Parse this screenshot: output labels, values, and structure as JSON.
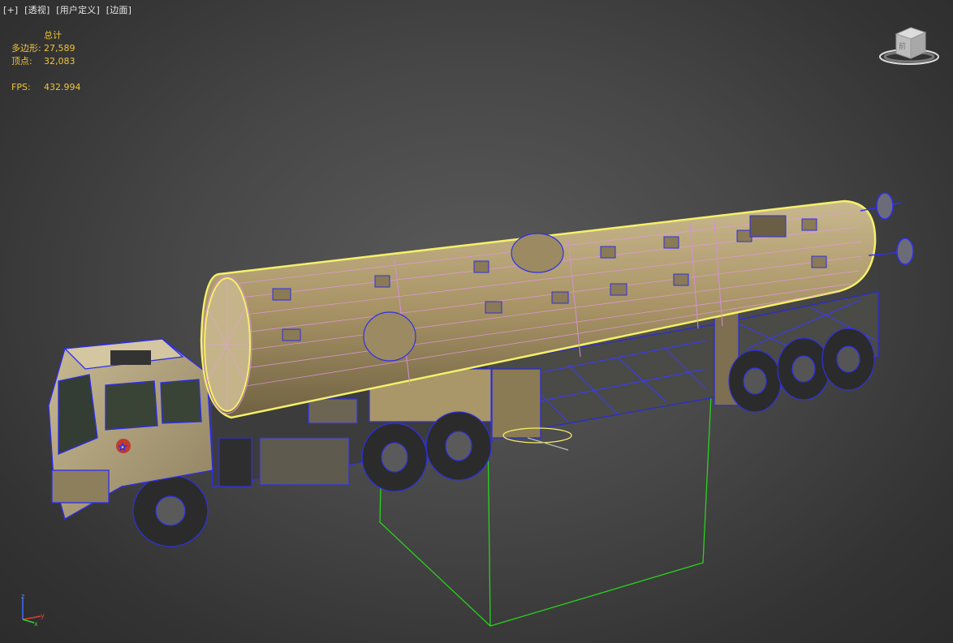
{
  "viewport": {
    "labels": [
      "[+]",
      "[透视]",
      "[用户定义]",
      "[边面]"
    ]
  },
  "stats": {
    "header": "总计",
    "polys_label": "多边形:",
    "polys_value": "27,589",
    "verts_label": "顶点:",
    "verts_value": "32,083",
    "fps_label": "FPS:",
    "fps_value": "432.994"
  },
  "viewcube": {
    "face_label": "前"
  },
  "axis": {
    "x": "x",
    "y": "y",
    "z": "z"
  },
  "colors": {
    "stats_text": "#f0c43a",
    "wire": "#3e3ef0",
    "selection": "#f5f06a",
    "gizmo_box": "#29d21e",
    "body_tan": "#b49f72"
  }
}
